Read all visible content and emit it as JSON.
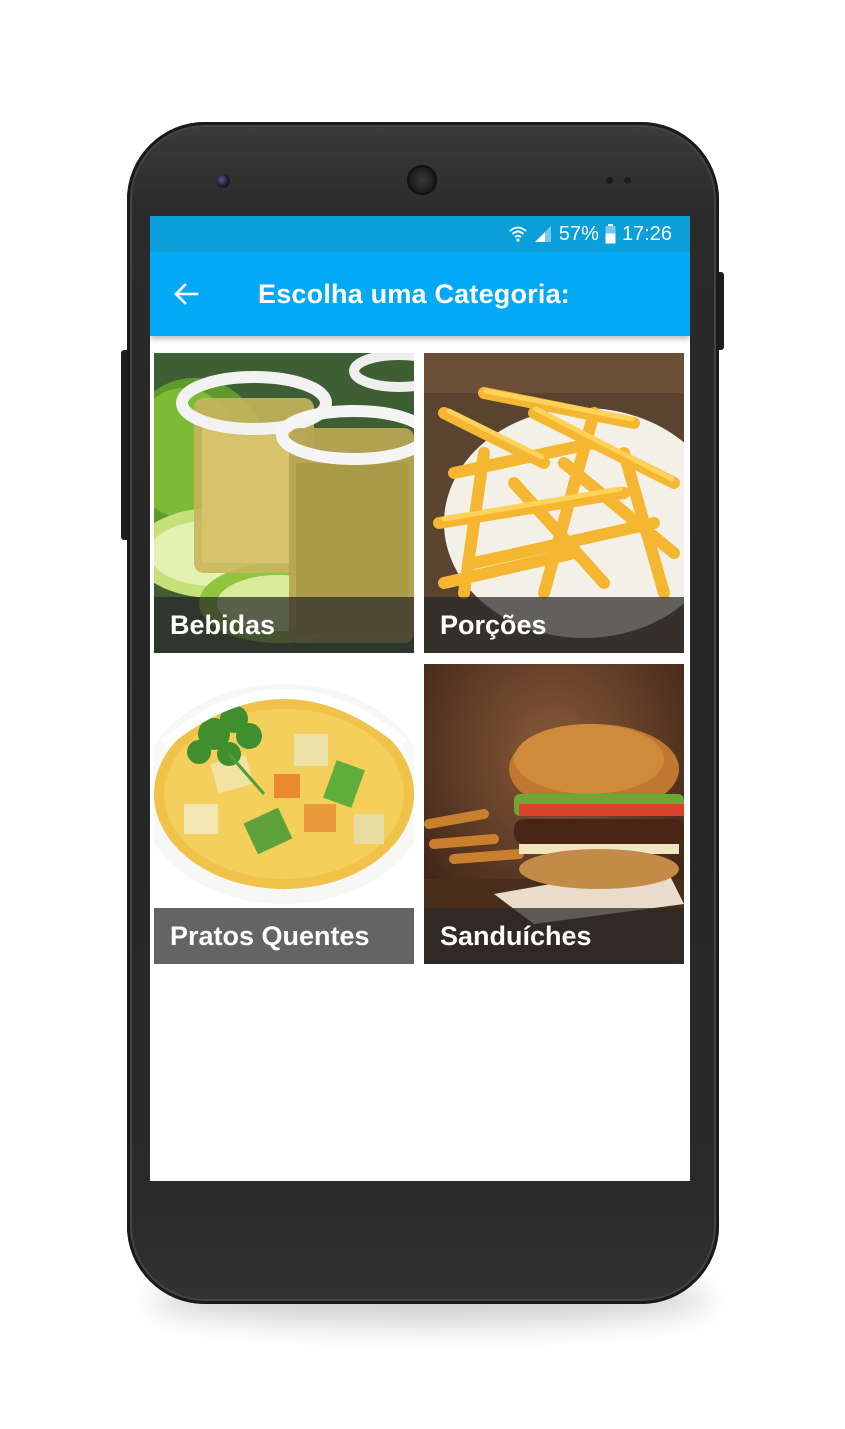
{
  "status_bar": {
    "battery": "57%",
    "time": "17:26",
    "icons": [
      "wifi-icon",
      "signal-icon",
      "battery-icon"
    ]
  },
  "app_bar": {
    "title": "Escolha uma Categoria:",
    "back_icon": "arrow-back-icon",
    "color": "#03a9f4"
  },
  "categories": [
    {
      "label": "Bebidas",
      "image": "tequila-shots-with-lime"
    },
    {
      "label": "Porções",
      "image": "french-fries"
    },
    {
      "label": "Pratos Quentes",
      "image": "vegetable-soup"
    },
    {
      "label": "Sanduíches",
      "image": "burger"
    }
  ]
}
